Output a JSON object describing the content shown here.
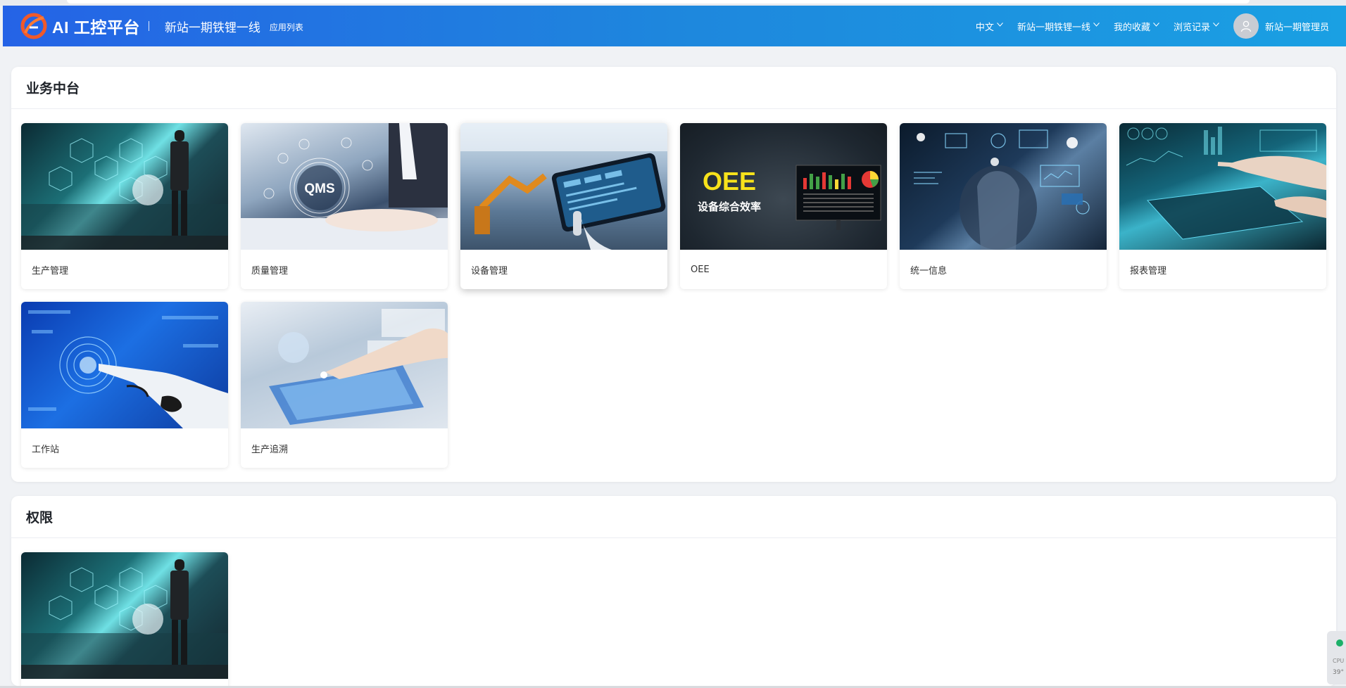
{
  "header": {
    "brand_title": "AI 工控平台",
    "site_name": "新站一期铁锂一线",
    "app_list_link": "应用列表",
    "nav": [
      {
        "label": "中文"
      },
      {
        "label": "新站一期铁锂一线"
      },
      {
        "label": "我的收藏"
      },
      {
        "label": "浏览记录"
      }
    ],
    "user_name": "新站一期管理员"
  },
  "sections": [
    {
      "title": "业务中台",
      "cards": [
        {
          "label": "生产管理",
          "image": "control-room"
        },
        {
          "label": "质量管理",
          "image": "qms"
        },
        {
          "label": "设备管理",
          "image": "robot-tablet"
        },
        {
          "label": "OEE",
          "image": "oee"
        },
        {
          "label": "统一信息",
          "image": "data-touch"
        },
        {
          "label": "报表管理",
          "image": "hand-tablet"
        },
        {
          "label": "工作站",
          "image": "robot-hand"
        },
        {
          "label": "生产追溯",
          "image": "globe-touch"
        }
      ]
    },
    {
      "title": "权限",
      "cards": [
        {
          "label": "",
          "image": "control-room"
        }
      ]
    }
  ],
  "images": {
    "oee_title": "OEE",
    "oee_subtitle": "设备综合效率",
    "qms_text": "QMS"
  },
  "widget": {
    "line1": "CPU",
    "line2": "39°"
  }
}
